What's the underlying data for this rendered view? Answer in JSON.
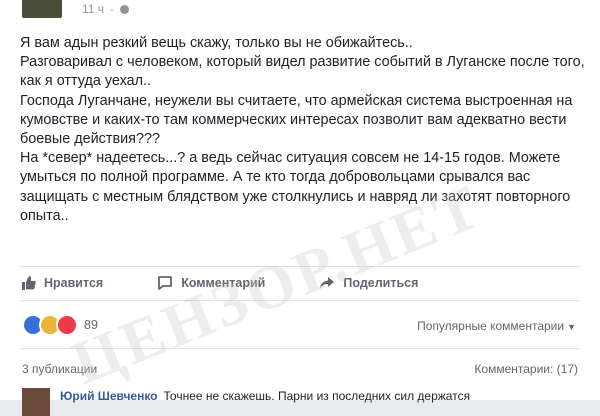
{
  "post": {
    "time": "11 ч",
    "privacy_icon": "globe-icon",
    "text": "Я вам адын резкий вещь скажу, только вы не обижайтесь..\nРазговаривал с человеком, который видел развитие событий в Луганске после того, как я оттуда уехал..\nГоспода Луганчане, неужели вы считаете, что армейская система выстроенная на кумовстве и каких-то там коммерческих интересах позволит вам адекватно вести боевые действия???\nНа *север* надеетесь...? а ведь сейчас ситуация совсем не 14-15 годов. Можете умыться по полной программе. А те кто тогда добровольцами срывался вас защищать с местным блядством уже столкнулись и навряд ли захотят повторного опыта.."
  },
  "actions": {
    "like": "Нравится",
    "comment": "Комментарий",
    "share": "Поделиться"
  },
  "reactions": {
    "count": "89",
    "icons": [
      "like-reaction-icon",
      "angry-reaction-icon",
      "love-reaction-icon"
    ]
  },
  "comments_header": {
    "sort_label": "Популярные комментарии",
    "publications": "3 публикации",
    "comments_label": "Комментарии: (17)"
  },
  "first_comment": {
    "author": "Юрий Шевченко",
    "text": "Точнее не скажешь. Парни из последних сил держатся"
  },
  "watermark": "ЦЕНЗОР.НЕТ",
  "colors": {
    "link": "#385898",
    "muted": "#606770",
    "text": "#1d2129"
  }
}
